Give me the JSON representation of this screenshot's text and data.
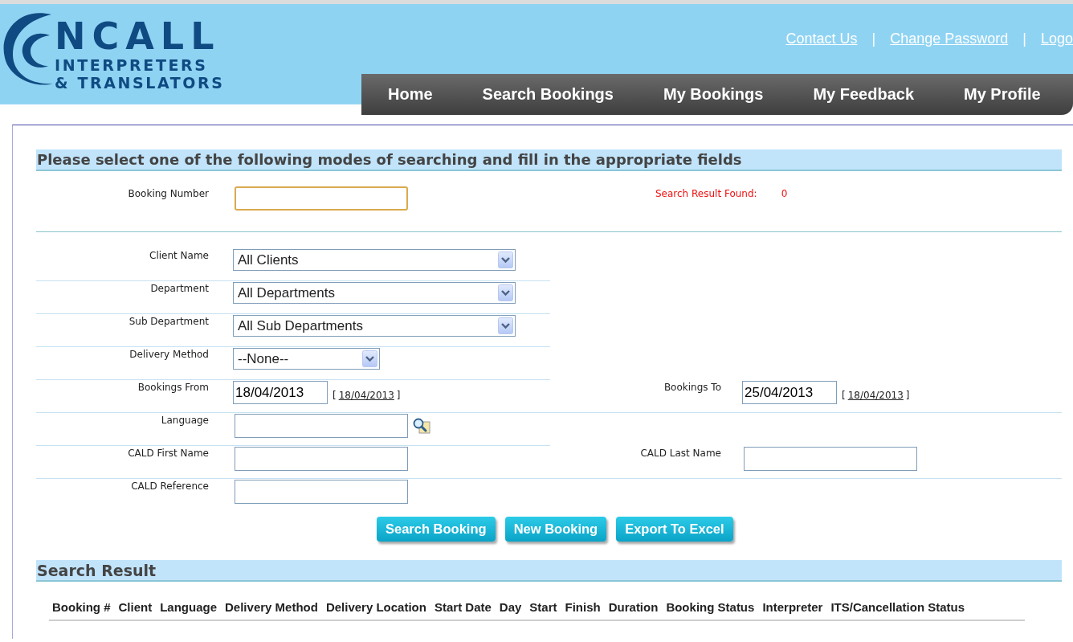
{
  "logo": {
    "word": "NCALL",
    "line_1": "INTERPRETERS",
    "line_2": "& TRANSLATORS"
  },
  "top_links": [
    {
      "label": "Contact Us"
    },
    {
      "label": "Change Password"
    },
    {
      "label": "Logo"
    }
  ],
  "link_separator": "|",
  "nav": [
    {
      "label": "Home"
    },
    {
      "label": "Search Bookings"
    },
    {
      "label": "My Bookings"
    },
    {
      "label": "My Feedback"
    },
    {
      "label": "My Profile"
    }
  ],
  "search_form": {
    "heading": "Please select one of the following modes of searching and fill in the appropriate fields",
    "booking_number": {
      "label": "Booking Number",
      "focused": true
    },
    "result_count": {
      "label": "Search Result Found:",
      "value": "0"
    },
    "rows": [
      {
        "left": {
          "kind": "select",
          "label": "Client Name",
          "value": "All Clients"
        }
      },
      {
        "left": {
          "kind": "select",
          "label": "Department",
          "value": "All Departments"
        }
      },
      {
        "left": {
          "kind": "select",
          "label": "Sub Department",
          "value": "All Sub Departments"
        }
      },
      {
        "left": {
          "kind": "small_select",
          "label": "Delivery Method",
          "value": "--None--"
        }
      },
      {
        "left": {
          "kind": "date",
          "label": "Bookings From",
          "value": "18/04/2013",
          "today": {
            "open": "[",
            "link": "18/04/2013",
            "close": "]"
          }
        },
        "right": {
          "kind": "date",
          "label": "Bookings To",
          "value": "25/04/2013",
          "today": {
            "open": "[",
            "link": "18/04/2013",
            "close": "]"
          }
        }
      },
      {
        "left": {
          "kind": "lookup",
          "label": "Language"
        }
      },
      {
        "left": {
          "kind": "text",
          "label": "CALD First Name"
        },
        "right": {
          "kind": "text",
          "label": "CALD Last Name"
        }
      },
      {
        "left": {
          "kind": "text",
          "label": "CALD Reference"
        }
      }
    ],
    "buttons": [
      {
        "label": "Search Booking"
      },
      {
        "label": "New Booking"
      },
      {
        "label": "Export To Excel"
      }
    ]
  },
  "search_result": {
    "heading": "Search Result",
    "columns": [
      "Booking #",
      "Client",
      "Language",
      "Delivery Method",
      "Delivery Location",
      "Start Date",
      "Day",
      "Start",
      "Finish",
      "Duration",
      "Booking Status",
      "Interpreter",
      "ITS/Cancellation Status"
    ]
  }
}
